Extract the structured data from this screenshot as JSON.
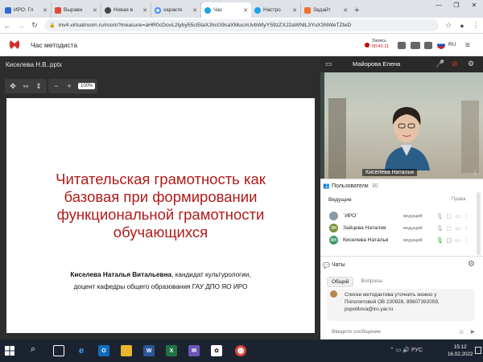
{
  "browser": {
    "tabs": [
      {
        "label": "ИРО: Гл",
        "fav_color": "#3367d6",
        "active": false
      },
      {
        "label": "Выравн",
        "fav_color": "#e04a3a",
        "active": false
      },
      {
        "label": "Новая в",
        "fav_color": "#444444",
        "active": false
      },
      {
        "label": "характе",
        "fav_color": "#4285f4",
        "active": false
      },
      {
        "label": "Час",
        "fav_color": "#1aa3e8",
        "active": true
      },
      {
        "label": "Настро",
        "fav_color": "#1aa3e8",
        "active": false
      },
      {
        "label": "Задайт",
        "fav_color": "#f07030",
        "active": false
      }
    ],
    "new_tab": "+",
    "window_controls": [
      "—",
      "❐",
      "✕"
    ],
    "url": "mv4.virtualroom.ru/room?measure=aHR0cDovL2lyby55ci5taXJhcG9saXMucnUvbWlyY59zZXJ2aWNlL3YuX3NWeTZteD"
  },
  "app": {
    "room_title": "Час методиста",
    "record_label": "Запись",
    "record_time": "00:41:11",
    "language": "RU",
    "brand_color": "#d32f2f"
  },
  "presentation": {
    "file_title": "Киселева Н.В..pptx",
    "zoom_out": "−",
    "zoom_in": "+",
    "zoom_level": "100%",
    "slide_title": "Читательская грамотность как базовая при формировании функциональной грамотности обучающихся",
    "slide_author": "Киселева Наталья Витальевна",
    "slide_author_rest": ", кандидат культурологии,",
    "slide_position": "доцент кафедры общего образования ГАУ ДПО ЯО ИРО",
    "title_color": "#b21a1a"
  },
  "video": {
    "header_name": "Майорова Елена",
    "speaker_label": "Киселева Наталья"
  },
  "users": {
    "header": "Пользователи",
    "count": "30",
    "section_hosts": "Ведущие",
    "section_rights": "Права",
    "list": [
      {
        "initials": "",
        "name": "`ИРО`",
        "role": "ведущий",
        "avatar_color": "#8d9aa6"
      },
      {
        "initials": "ЗН",
        "name": "Зайцева Наталия",
        "role": "ведущий",
        "avatar_color": "#7a8f3a"
      },
      {
        "initials": "КН",
        "name": "Киселева Наталья",
        "role": "ведущий",
        "avatar_color": "#3f9a6b"
      }
    ]
  },
  "chat": {
    "header": "Чаты",
    "tab_general": "Общий",
    "tab_questions": "Вопросы",
    "message": "Списки методактива уточнить можно у Пополитовой ОВ 230928, 89607392059, popolitova@iro.yar.ru",
    "input_placeholder": "Введите сообщение"
  },
  "taskbar": {
    "lang": "РУС",
    "time": "15:12",
    "date": "16.02.2022"
  }
}
